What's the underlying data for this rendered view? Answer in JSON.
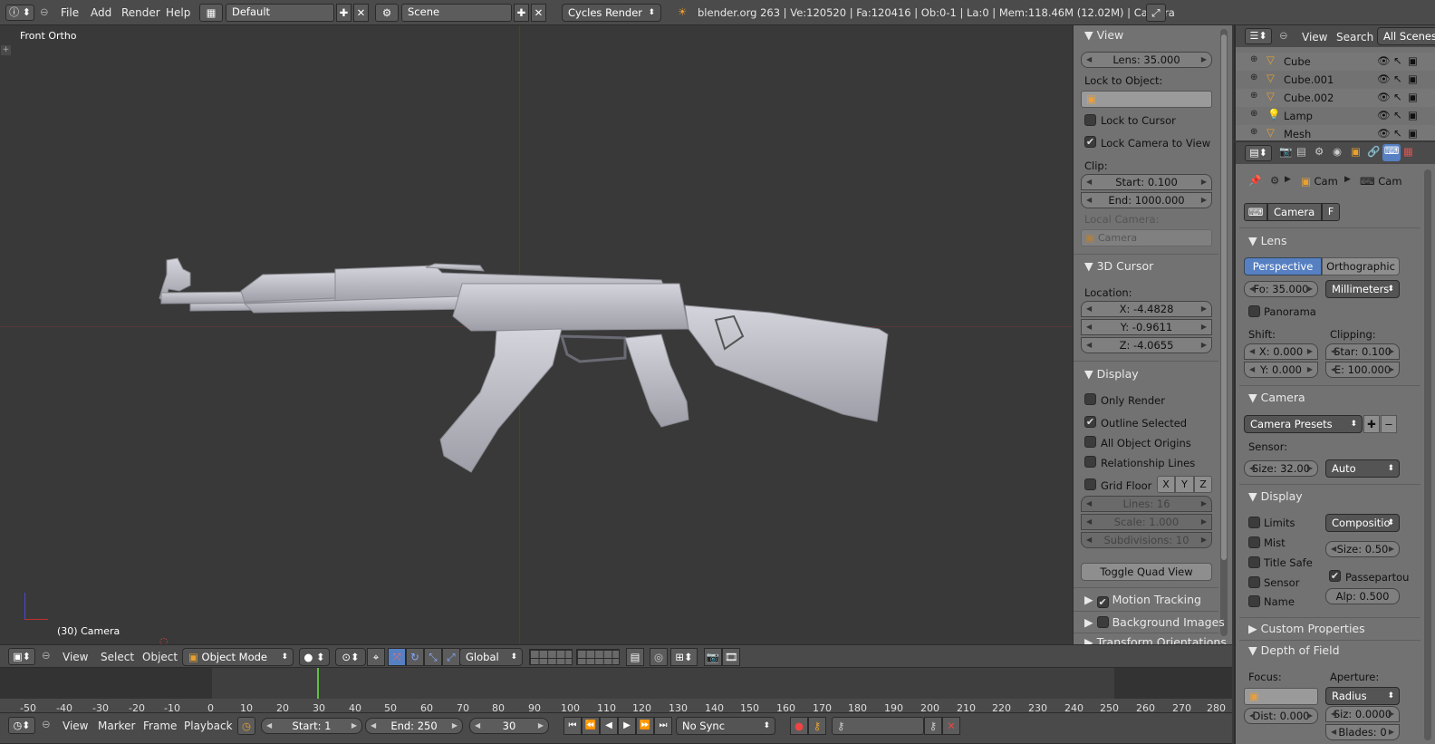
{
  "top_bar": {
    "menus": [
      "File",
      "Add",
      "Render",
      "Help"
    ],
    "layout": "Default",
    "scene": "Scene",
    "engine": "Cycles Render",
    "stats": "blender.org 263 | Ve:120520 | Fa:120416 | Ob:0-1 | La:0 | Mem:118.46M (12.02M) | Camera"
  },
  "viewport": {
    "view_label": "Front Ortho",
    "object_label": "(30) Camera"
  },
  "n_panel": {
    "view": {
      "header": "View",
      "lens": "Lens: 35.000",
      "lock_to_object": "Lock to Object:",
      "lock_to_cursor": "Lock to Cursor",
      "lock_camera_to_view": "Lock Camera to View",
      "clip": "Clip:",
      "clip_start": "Start: 0.100",
      "clip_end": "End: 1000.000",
      "local_camera": "Local Camera:",
      "local_camera_value": "Camera"
    },
    "cursor": {
      "header": "3D Cursor",
      "location": "Location:",
      "x": "X: -4.4828",
      "y": "Y: -0.9611",
      "z": "Z: -4.0655"
    },
    "display": {
      "header": "Display",
      "only_render": "Only Render",
      "outline_selected": "Outline Selected",
      "all_object_origins": "All Object Origins",
      "relationship_lines": "Relationship Lines",
      "grid_floor": "Grid Floor",
      "axes": [
        "X",
        "Y",
        "Z"
      ],
      "lines": "Lines: 16",
      "scale": "Scale: 1.000",
      "subdivisions": "Subdivisions: 10",
      "toggle_quad": "Toggle Quad View"
    },
    "motion_tracking": "Motion Tracking",
    "background_images": "Background Images",
    "transform_orientations": "Transform Orientations"
  },
  "outliner": {
    "menus": [
      "View",
      "Search"
    ],
    "scope": "All Scenes",
    "items": [
      "Cube",
      "Cube.001",
      "Cube.002",
      "Lamp",
      "Mesh"
    ]
  },
  "properties": {
    "breadcrumb": [
      "Cam",
      "Cam"
    ],
    "datablock": "Camera",
    "fake_user": "F",
    "lens": {
      "header": "Lens",
      "perspective": "Perspective",
      "orthographic": "Orthographic",
      "focal": "Fo: 35.000",
      "units": "Millimeters",
      "panorama": "Panorama",
      "shift": "Shift:",
      "clipping": "Clipping:",
      "shift_x": "X: 0.000",
      "shift_y": "Y: 0.000",
      "clip_start": "Star: 0.100",
      "clip_end": "E: 100.000"
    },
    "camera": {
      "header": "Camera",
      "presets": "Camera Presets",
      "sensor": "Sensor:",
      "size": "Size: 32.00",
      "fit": "Auto"
    },
    "display": {
      "header": "Display",
      "limits": "Limits",
      "composition": "Compositio",
      "mist": "Mist",
      "size": "Size: 0.50",
      "title_safe": "Title Safe",
      "passepartout": "Passepartou",
      "sensor": "Sensor",
      "alpha": "Alp: 0.500",
      "name": "Name"
    },
    "custom_properties": "Custom Properties",
    "dof": {
      "header": "Depth of Field",
      "focus": "Focus:",
      "aperture": "Aperture:",
      "radius": "Radius",
      "distance": "Dist: 0.000",
      "aperture_size": "Siz: 0.0000",
      "blades": "Blades: 0"
    }
  },
  "view3d_header": {
    "menus": [
      "View",
      "Select",
      "Object"
    ],
    "mode": "Object Mode",
    "orientation": "Global"
  },
  "timeline": {
    "ticks": [
      "-50",
      "-40",
      "-30",
      "-20",
      "-10",
      "0",
      "10",
      "20",
      "30",
      "40",
      "50",
      "60",
      "70",
      "80",
      "90",
      "100",
      "110",
      "120",
      "130",
      "140",
      "150",
      "160",
      "170",
      "180",
      "190",
      "200",
      "210",
      "220",
      "230",
      "240",
      "250",
      "260",
      "270",
      "280"
    ],
    "menus": [
      "View",
      "Marker",
      "Frame",
      "Playback"
    ],
    "start": "Start: 1",
    "end": "End: 250",
    "current": "30",
    "sync": "No Sync"
  },
  "colors": {
    "accent": "#5680c2",
    "grid_x": "#7a3a3a",
    "grid_y": "#3c3c80"
  }
}
